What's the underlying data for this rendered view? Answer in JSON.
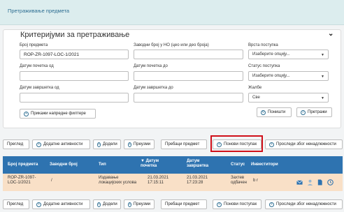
{
  "header": {
    "title": "Претраживање предмета"
  },
  "search": {
    "title": "Критеријуми за претраживање",
    "fields": {
      "case_number": {
        "label": "Број предмета",
        "value": "ROP-ZR-1097-LOC-1/2021"
      },
      "filing_number": {
        "label": "Заводни број у НО (цео или део броја)",
        "value": ""
      },
      "procedure_type": {
        "label": "Врста поступка",
        "value": "Изаберите опцију..."
      },
      "start_from": {
        "label": "Датум почетка од",
        "value": ""
      },
      "start_to": {
        "label": "Датум почетка до",
        "value": ""
      },
      "procedure_status": {
        "label": "Статус поступка",
        "value": "Изаберите опцију..."
      },
      "end_from": {
        "label": "Датум завршетка од",
        "value": ""
      },
      "end_to": {
        "label": "Датум завршетка до",
        "value": ""
      },
      "complaints": {
        "label": "Жалбе",
        "value": "Све"
      }
    },
    "advanced_filters_label": "Прикажи напредне филтере",
    "reset_label": "Поништи",
    "search_label": "Претражи"
  },
  "toolbar": {
    "view": "Преглед",
    "additional": "Додатне активности",
    "assign": "Додели",
    "take": "Преузми",
    "transfer": "Пребаци предмет",
    "repeat": "Понови поступак",
    "forward": "Проследи због ненадлежности"
  },
  "table": {
    "headers": {
      "number": "Број предмета",
      "filing": "Заводни број",
      "type": "Тип",
      "start_a": "▼ Датум",
      "start_b": "почетка",
      "end_a": "Датум",
      "end_b": "завршетка",
      "status": "Статус",
      "investor": "Инвеститори"
    },
    "rows": [
      {
        "number_a": "ROP-ZR-1097-",
        "number_b": "LOC-1/2021",
        "filing": "/",
        "type_a": "Издавање",
        "type_b": "локацијских услова",
        "start_a": "21.03.2021",
        "start_b": "17:15:11",
        "end_a": "21.03.2021",
        "end_b": "17:23:28",
        "status_a": "Захтев",
        "status_b": "одбачен",
        "investor": "b r"
      }
    ]
  },
  "colors": {
    "header_bar": "#dcedee",
    "table_header": "#2e73b0",
    "row_highlight": "#f9e0c7",
    "selection_box": "#d0101a"
  },
  "icons": [
    "chevron-down-icon",
    "plus-circle-icon",
    "refresh-icon",
    "search-icon",
    "mail-icon",
    "user-icon",
    "document-icon",
    "clock-icon"
  ]
}
